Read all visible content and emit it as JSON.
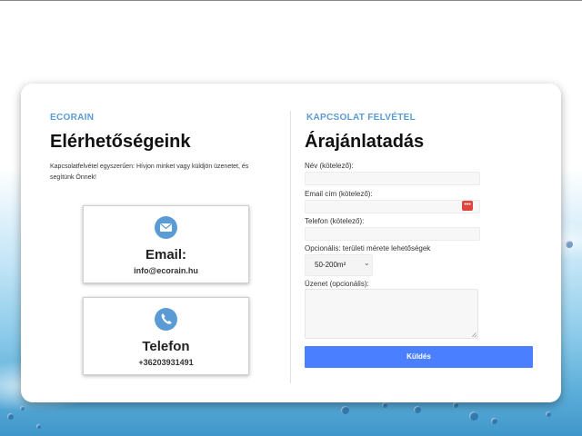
{
  "left": {
    "eyebrow": "ECORAIN",
    "title": "Elérhetőségeink",
    "intro": "Kapcsolatfelvétel egyszerűen: Hívjon minket vagy küldjön üzenetet, és segítünk Önnek!",
    "contacts": [
      {
        "icon": "envelope-icon",
        "title": "Email:",
        "value": "info@ecorain.hu"
      },
      {
        "icon": "phone-icon",
        "title": "Telefon",
        "value": "+36203931491"
      }
    ]
  },
  "form": {
    "eyebrow": "KAPCSOLAT FELVÉTEL",
    "title": "Árajánlatadás",
    "name_label": "Név (kötelező):",
    "name_value": "",
    "email_label": "Email cím (kötelező):",
    "email_value": "",
    "phone_label": "Telefon (kötelező):",
    "phone_value": "",
    "area_label": "Opcionális: területi mérete lehetőségek",
    "area_selected": "50-200m²",
    "message_label": "Üzenet (opcionális):",
    "message_value": "",
    "submit_label": "Küldés"
  },
  "colors": {
    "accent": "#5b9bd5",
    "button": "#4a7fff",
    "password_manager_icon": "#e0443e"
  }
}
